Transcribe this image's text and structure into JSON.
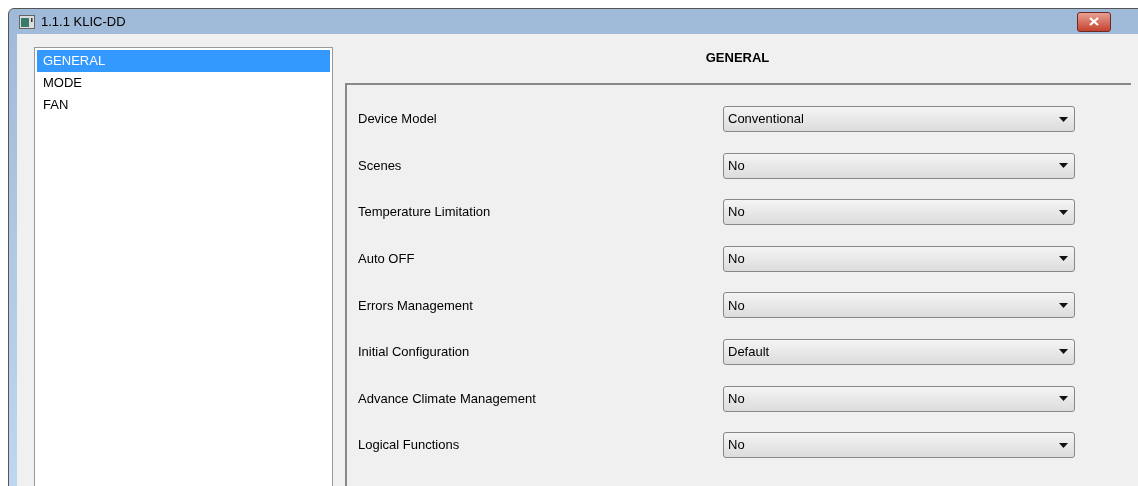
{
  "window": {
    "title": "1.1.1 KLIC-DD"
  },
  "sidebar": {
    "items": [
      {
        "label": "GENERAL",
        "selected": true
      },
      {
        "label": "MODE",
        "selected": false
      },
      {
        "label": "FAN",
        "selected": false
      }
    ]
  },
  "panel": {
    "title": "GENERAL",
    "rows": [
      {
        "label": "Device Model",
        "value": "Conventional"
      },
      {
        "label": "Scenes",
        "value": "No"
      },
      {
        "label": "Temperature Limitation",
        "value": "No"
      },
      {
        "label": "Auto OFF",
        "value": "No"
      },
      {
        "label": "Errors Management",
        "value": "No"
      },
      {
        "label": "Initial Configuration",
        "value": "Default"
      },
      {
        "label": "Advance Climate Management",
        "value": "No"
      },
      {
        "label": "Logical Functions",
        "value": "No"
      }
    ]
  }
}
